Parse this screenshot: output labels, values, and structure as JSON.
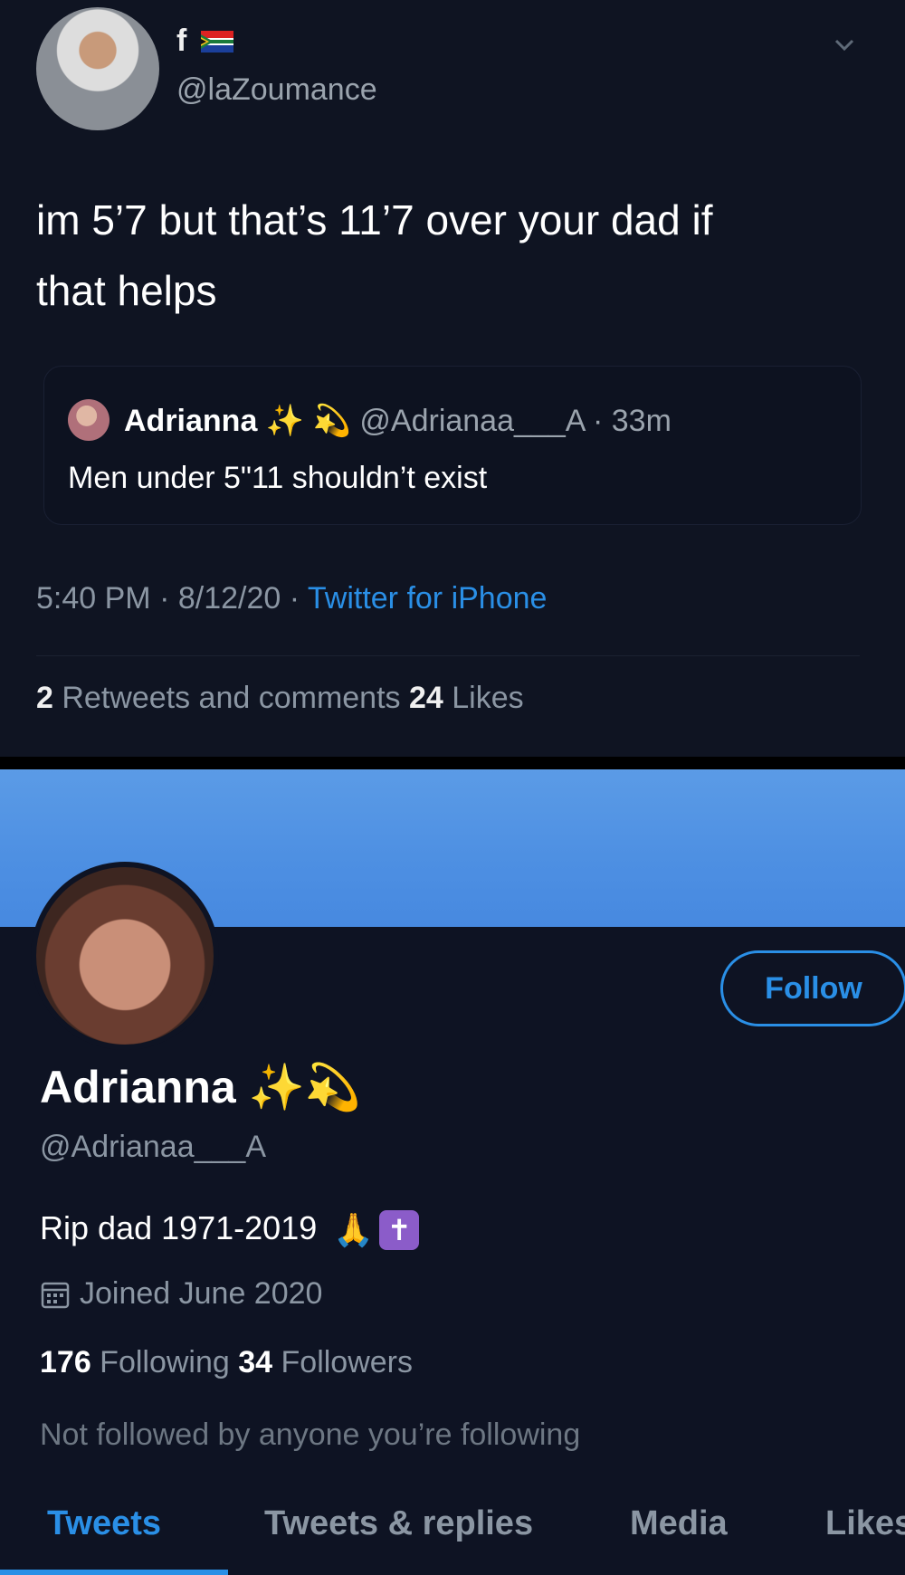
{
  "tweet": {
    "author_name": "f",
    "author_handle": "@laZoumance",
    "text_line1": "im 5’7 but that’s 11’7 over your dad if",
    "text_line2": "that helps",
    "quote": {
      "name": "Adrianna",
      "handle_time": "@Adrianaa___A · 33m",
      "text": "Men under 5\"11 shouldn’t exist"
    },
    "timestamp": "5:40 PM · 8/12/20 · ",
    "source": "Twitter for iPhone",
    "retweets_count": "2",
    "retweets_label": " Retweets and comments  ",
    "likes_count": "24",
    "likes_label": " Likes"
  },
  "profile": {
    "name": "Adrianna",
    "handle": "@Adrianaa___A",
    "bio": "Rip dad 1971-2019",
    "joined": "Joined June 2020",
    "following_count": "176",
    "following_label": " Following   ",
    "followers_count": "34",
    "followers_label": " Followers",
    "not_followed": "Not followed by anyone you’re following",
    "follow_button": "Follow",
    "tabs": [
      "Tweets",
      "Tweets & replies",
      "Media",
      "Likes"
    ]
  },
  "colors": {
    "accent": "#2a8fe6",
    "banner": "#4d8fe2"
  }
}
